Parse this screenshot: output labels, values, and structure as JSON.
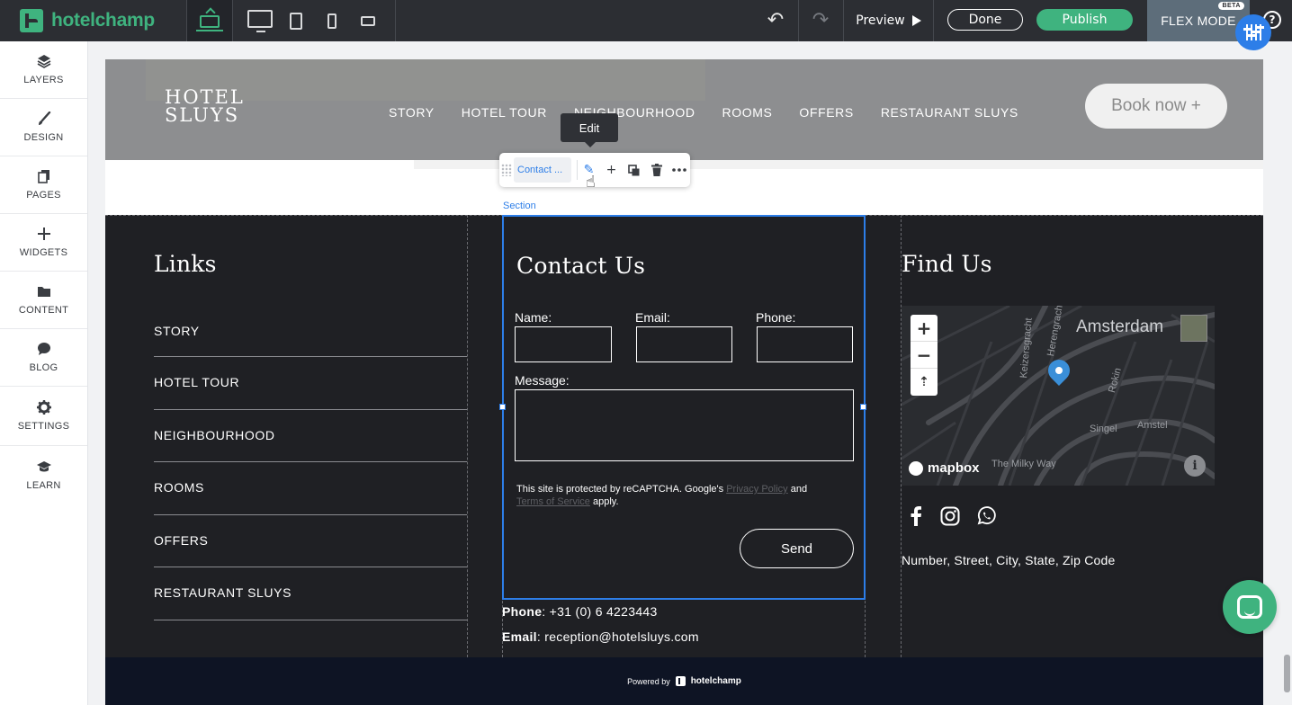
{
  "app": {
    "brand": "hotelchamp",
    "preview_label": "Preview",
    "done_label": "Done",
    "publish_label": "Publish",
    "flex_mode_label": "FLEX MODE",
    "beta_label": "BETA",
    "help_label": "?"
  },
  "sidebar": {
    "items": [
      {
        "label": "LAYERS",
        "icon": "layers-icon"
      },
      {
        "label": "DESIGN",
        "icon": "brush-icon"
      },
      {
        "label": "PAGES",
        "icon": "pages-icon"
      },
      {
        "label": "WIDGETS",
        "icon": "plus-icon"
      },
      {
        "label": "CONTENT",
        "icon": "folder-icon"
      },
      {
        "label": "BLOG",
        "icon": "chat-icon"
      },
      {
        "label": "SETTINGS",
        "icon": "gear-icon"
      },
      {
        "label": "LEARN",
        "icon": "graduation-cap-icon"
      }
    ]
  },
  "site_header": {
    "logo_line1": "HOTEL",
    "logo_line2": "SLUYS",
    "nav": [
      "STORY",
      "HOTEL TOUR",
      "NEIGHBOURHOOD",
      "ROOMS",
      "OFFERS",
      "RESTAURANT SLUYS"
    ],
    "book_label": "Book now +"
  },
  "editor": {
    "tooltip": "Edit",
    "breadcrumb_chip": "Contact ...",
    "section_label": "Section"
  },
  "footer": {
    "links_title": "Links",
    "links": [
      "STORY",
      "HOTEL TOUR",
      "NEIGHBOURHOOD",
      "ROOMS",
      "OFFERS",
      "RESTAURANT SLUYS"
    ],
    "contact_title": "Contact Us",
    "form": {
      "name_label": "Name:",
      "email_label": "Email:",
      "phone_label": "Phone:",
      "message_label": "Message:",
      "name_value": "",
      "email_value": "",
      "phone_value": "",
      "message_value": "",
      "recaptcha_prefix": "This site is protected by reCAPTCHA. Google's",
      "privacy_link": "Privacy Policy",
      "recaptcha_and": "and",
      "terms_link": "Terms of Service",
      "recaptcha_suffix": "apply.",
      "send_label": "Send"
    },
    "phone_key": "Phone",
    "phone_value": ": +31 (0) 6 4223443",
    "email_key": "Email",
    "email_value": ": reception@hotelsluys.com",
    "find_title": "Find Us",
    "map": {
      "city": "Amsterdam",
      "labels": [
        "Keizersgracht",
        "Herengracht",
        "Rokin",
        "Singel",
        "Amstel",
        "The Milky Way"
      ],
      "attribution": "mapbox",
      "zoom_in": "+",
      "zoom_out": "−",
      "compass": "⇡",
      "info": "i"
    },
    "address": "Number, Street, City, State, Zip Code",
    "powered_prefix": "Powered by",
    "powered_brand": "hotelchamp"
  },
  "colors": {
    "brand_green": "#3fb37f",
    "selection_blue": "#2d7ee8",
    "topbar": "#2c2e33",
    "footer_bg": "#1f2024"
  }
}
